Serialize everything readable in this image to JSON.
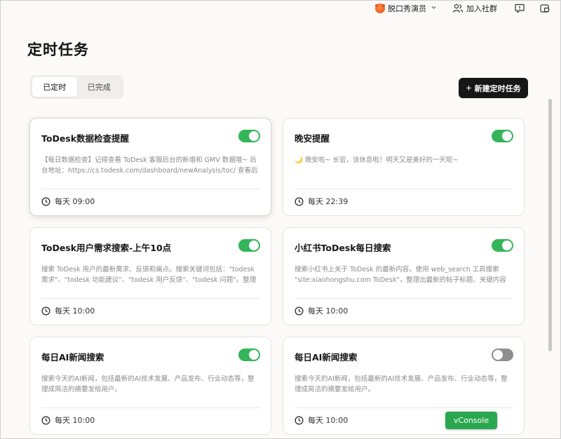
{
  "topbar": {
    "user_name": "脱口秀演员",
    "join_label": "加入社群"
  },
  "page": {
    "title": "定时任务"
  },
  "tabs": [
    {
      "label": "已定时",
      "active": true
    },
    {
      "label": "已完成",
      "active": false
    }
  ],
  "new_task_label": "新建定时任务",
  "cards": [
    {
      "title": "ToDesk数据检查提醒",
      "enabled": true,
      "desc": "【每日数据检查】记得查看 ToDesk 客服后台的新增和 GMV 数据哦~ 后台地址：https://cs.todesk.com/dashboard/newAnalysis/toc/ 查看后把关键...",
      "time": "每天 09:00"
    },
    {
      "title": "晚安提醒",
      "enabled": true,
      "desc": "🌙 晚安啦~ 长官，该休息啦！明天又是美好的一天呢~",
      "time": "每天 22:39"
    },
    {
      "title": "ToDesk用户需求搜索-上午10点",
      "enabled": true,
      "desc": "搜索 ToDesk 用户的最新需求、反馈和痛点。搜索关键词包括：\"todesk 需求\"、\"todesk 功能建议\"、\"todesk 用户反馈\"、\"todesk 问题\"。整理出用...",
      "time": "每天 10:00"
    },
    {
      "title": "小红书ToDesk每日搜索",
      "enabled": true,
      "desc": "搜索小红书上关于 ToDesk 的最新内容。使用 web_search 工具搜索 \"site:xiaohongshu.com ToDesk\"，整理出最新的帖子标题、关键内容和热...",
      "time": "每天 10:00"
    },
    {
      "title": "每日AI新闻搜索",
      "enabled": true,
      "desc": "搜索今天的AI新闻，包括最新的AI技术发展、产品发布、行业动态等，整理成简洁的摘要发给用户。",
      "time": "每天 10:00"
    },
    {
      "title": "每日AI新闻搜索",
      "enabled": false,
      "desc": "搜索今天的AI新闻，包括最新的AI技术发展、产品发布、行业动态等，整理成简洁的摘要发给用户。",
      "time": "每天 10:00"
    }
  ],
  "vconsole_label": "vConsole",
  "colors": {
    "toggle_on": "#34b55a",
    "toggle_off": "#8e8e8e",
    "primary_button": "#161616",
    "vconsole": "#2aa84f"
  }
}
